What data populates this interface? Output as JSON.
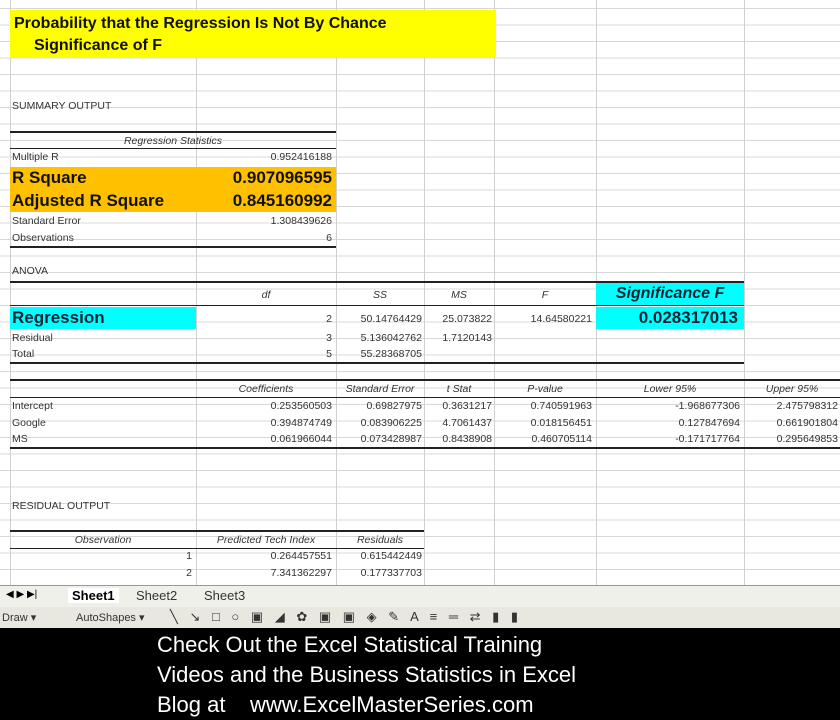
{
  "title": {
    "line1": "Probability that the Regression Is Not By Chance",
    "line2": "Significance of F"
  },
  "summary_label": "SUMMARY OUTPUT",
  "reg_stats": {
    "header": "Regression Statistics",
    "rows": [
      {
        "label": "Multiple R",
        "value": "0.952416188"
      },
      {
        "label": "R Square",
        "value": "0.907096595"
      },
      {
        "label": "Adjusted R Square",
        "value": "0.845160992"
      },
      {
        "label": "Standard Error",
        "value": "1.308439626"
      },
      {
        "label": "Observations",
        "value": "6"
      }
    ]
  },
  "anova": {
    "label": "ANOVA",
    "headers": [
      "df",
      "SS",
      "MS",
      "F",
      "Significance F"
    ],
    "rows": [
      {
        "label": "Regression",
        "df": "2",
        "ss": "50.14764429",
        "ms": "25.073822",
        "f": "14.64580221",
        "sig": "0.028317013"
      },
      {
        "label": "Residual",
        "df": "3",
        "ss": "5.136042762",
        "ms": "1.7120143"
      },
      {
        "label": "Total",
        "df": "5",
        "ss": "55.28368705"
      }
    ]
  },
  "coef": {
    "headers": [
      "Coefficients",
      "Standard Error",
      "t Stat",
      "P-value",
      "Lower 95%",
      "Upper 95%"
    ],
    "rows": [
      {
        "label": "Intercept",
        "v": [
          "0.253560503",
          "0.69827975",
          "0.3631217",
          "0.740591963",
          "-1.968677306",
          "2.475798312"
        ]
      },
      {
        "label": "Google",
        "v": [
          "0.394874749",
          "0.083906225",
          "4.7061437",
          "0.018156451",
          "0.127847694",
          "0.661901804"
        ]
      },
      {
        "label": "MS",
        "v": [
          "0.061966044",
          "0.073428987",
          "0.8438908",
          "0.460705114",
          "-0.171717764",
          "0.295649853"
        ]
      }
    ]
  },
  "residual": {
    "label": "RESIDUAL OUTPUT",
    "headers": [
      "Observation",
      "Predicted Tech Index",
      "Residuals"
    ],
    "rows": [
      {
        "obs": "1",
        "pred": "0.264457551",
        "res": "0.615442449"
      },
      {
        "obs": "2",
        "pred": "7.341362297",
        "res": "0.177337703"
      }
    ]
  },
  "sheets": [
    "Sheet1",
    "Sheet2",
    "Sheet3"
  ],
  "toolbar": {
    "draw": "Draw ▾",
    "autoshapes": "AutoShapes ▾"
  },
  "caption": {
    "line1": "Check Out the Excel Statistical Training",
    "line2": "Videos and the Business Statistics in Excel",
    "line3": "Blog at    www.ExcelMasterSeries.com"
  },
  "colors": {
    "yellow": "#ffff00",
    "orange": "#ffc000",
    "cyan": "#00ffff"
  }
}
